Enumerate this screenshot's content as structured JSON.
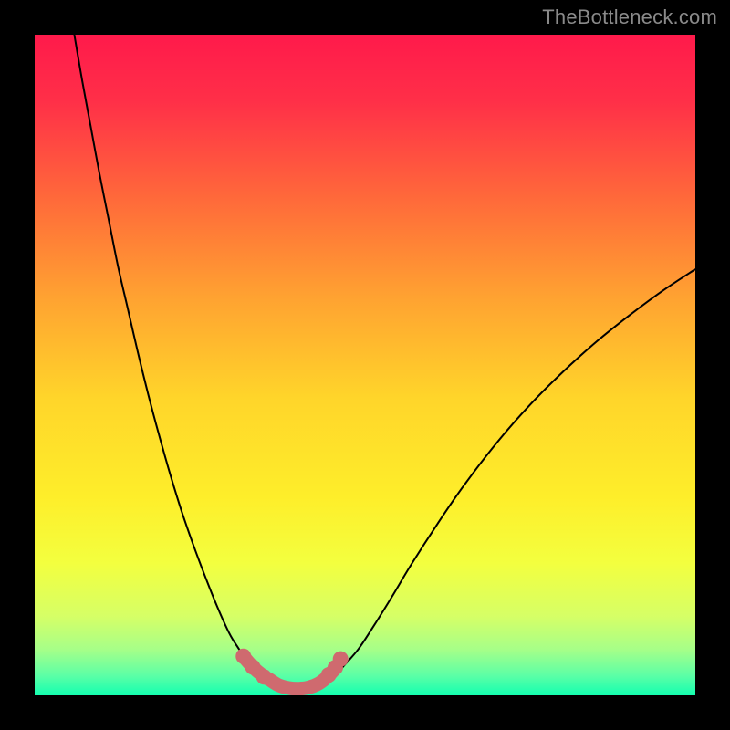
{
  "watermark": "TheBottleneck.com",
  "chart_data": {
    "type": "line",
    "title": "",
    "xlabel": "",
    "ylabel": "",
    "xlim": [
      0,
      1
    ],
    "ylim": [
      0,
      1
    ],
    "gradient_stops": [
      {
        "offset": 0.0,
        "color": "#ff1a4b"
      },
      {
        "offset": 0.1,
        "color": "#ff2f48"
      },
      {
        "offset": 0.25,
        "color": "#ff6a3a"
      },
      {
        "offset": 0.4,
        "color": "#ffa331"
      },
      {
        "offset": 0.55,
        "color": "#ffd52a"
      },
      {
        "offset": 0.7,
        "color": "#feee2a"
      },
      {
        "offset": 0.8,
        "color": "#f3ff3f"
      },
      {
        "offset": 0.88,
        "color": "#d6ff66"
      },
      {
        "offset": 0.93,
        "color": "#a7ff88"
      },
      {
        "offset": 0.97,
        "color": "#5cffa6"
      },
      {
        "offset": 1.0,
        "color": "#13ffb0"
      }
    ],
    "series": [
      {
        "name": "bottleneck-curve",
        "color": "#000000",
        "width": 2,
        "x": [
          0.06,
          0.072,
          0.085,
          0.098,
          0.112,
          0.126,
          0.141,
          0.156,
          0.172,
          0.188,
          0.205,
          0.222,
          0.24,
          0.258,
          0.276,
          0.294,
          0.306,
          0.318,
          0.33,
          0.338,
          0.35,
          0.37,
          0.39,
          0.41,
          0.425,
          0.44,
          0.455,
          0.47,
          0.49,
          0.51,
          0.54,
          0.57,
          0.61,
          0.65,
          0.7,
          0.75,
          0.8,
          0.85,
          0.9,
          0.95,
          1.0
        ],
        "y": [
          1.0,
          0.93,
          0.86,
          0.79,
          0.72,
          0.65,
          0.585,
          0.52,
          0.455,
          0.395,
          0.335,
          0.28,
          0.228,
          0.18,
          0.135,
          0.095,
          0.075,
          0.057,
          0.041,
          0.033,
          0.023,
          0.013,
          0.009,
          0.009,
          0.012,
          0.019,
          0.031,
          0.047,
          0.07,
          0.1,
          0.148,
          0.198,
          0.26,
          0.318,
          0.383,
          0.44,
          0.49,
          0.535,
          0.575,
          0.612,
          0.645
        ]
      }
    ],
    "highlight": {
      "name": "bottleneck-optimal-zone",
      "color": "#cf6a6f",
      "stroke_width": 15,
      "x": [
        0.315,
        0.33,
        0.345,
        0.355,
        0.37,
        0.385,
        0.4,
        0.415,
        0.43,
        0.443,
        0.456
      ],
      "y": [
        0.06,
        0.043,
        0.03,
        0.024,
        0.015,
        0.011,
        0.01,
        0.012,
        0.018,
        0.028,
        0.042
      ],
      "dots": {
        "r": 8.5,
        "points": [
          {
            "x": 0.316,
            "y": 0.059
          },
          {
            "x": 0.33,
            "y": 0.043
          },
          {
            "x": 0.347,
            "y": 0.028
          },
          {
            "x": 0.445,
            "y": 0.031
          },
          {
            "x": 0.455,
            "y": 0.042
          },
          {
            "x": 0.463,
            "y": 0.055
          }
        ]
      }
    }
  }
}
